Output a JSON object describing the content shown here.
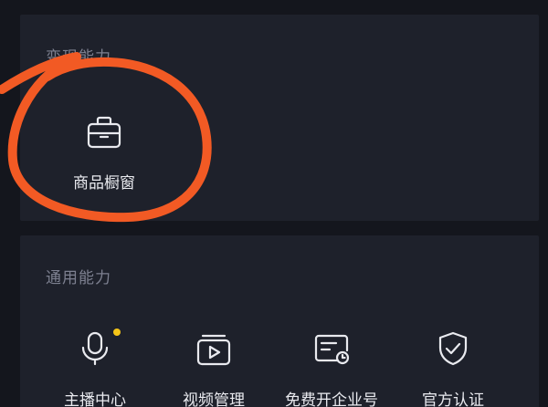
{
  "monetization": {
    "title": "变现能力",
    "items": [
      {
        "label": "商品橱窗",
        "icon": "storefront-bag-icon"
      }
    ]
  },
  "general": {
    "title": "通用能力",
    "items": [
      {
        "label": "主播中心",
        "icon": "microphone-icon",
        "badge": "dot"
      },
      {
        "label": "视频管理",
        "icon": "video-manage-icon"
      },
      {
        "label": "免费开企业号",
        "icon": "enterprise-card-icon"
      },
      {
        "label": "官方认证",
        "icon": "shield-check-icon"
      }
    ]
  },
  "colors": {
    "page_bg": "#14161d",
    "card_bg": "#1e212b",
    "section_title": "#7d8090",
    "label": "#e9eaef",
    "badge_dot": "#f5c518",
    "annotation_stroke": "#f25a24"
  },
  "annotation": {
    "type": "freehand-circle",
    "target": "商品橱窗"
  }
}
